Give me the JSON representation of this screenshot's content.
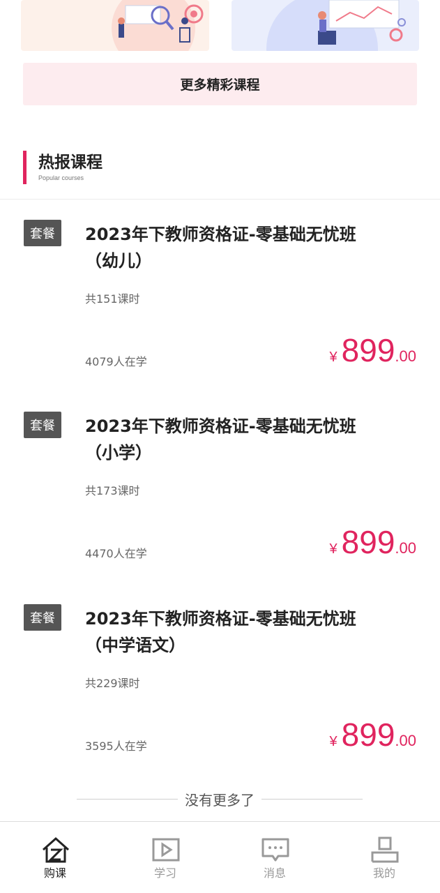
{
  "more_courses_label": "更多精彩课程",
  "section": {
    "title": "热报课程",
    "subtitle": "Popular courses"
  },
  "courses": [
    {
      "tag": "套餐",
      "name": "2023年下教师资格证-零基础无忧班（幼儿）",
      "lessons": "共151课时",
      "learners": "4079人在学",
      "currency": "¥",
      "price_int": "899",
      "price_dec": ".00"
    },
    {
      "tag": "套餐",
      "name": "2023年下教师资格证-零基础无忧班（小学）",
      "lessons": "共173课时",
      "learners": "4470人在学",
      "currency": "¥",
      "price_int": "899",
      "price_dec": ".00"
    },
    {
      "tag": "套餐",
      "name": "2023年下教师资格证-零基础无忧班（中学语文）",
      "lessons": "共229课时",
      "learners": "3595人在学",
      "currency": "¥",
      "price_int": "899",
      "price_dec": ".00"
    }
  ],
  "no_more_text": "没有更多了",
  "tabs": [
    {
      "label": "购课",
      "icon": "home-cart-icon",
      "active": true
    },
    {
      "label": "学习",
      "icon": "play-icon",
      "active": false
    },
    {
      "label": "消息",
      "icon": "message-icon",
      "active": false
    },
    {
      "label": "我的",
      "icon": "profile-icon",
      "active": false
    }
  ],
  "colors": {
    "accent": "#e0245e",
    "tag_bg": "#555555",
    "more_bg": "#fdecef"
  }
}
